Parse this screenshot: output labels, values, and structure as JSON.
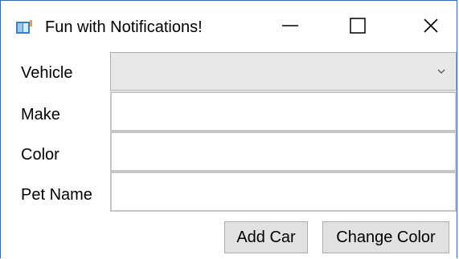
{
  "window": {
    "title": "Fun with Notifications!"
  },
  "form": {
    "vehicle_label": "Vehicle",
    "make_label": "Make",
    "color_label": "Color",
    "pet_name_label": "Pet Name",
    "vehicle_selected": "",
    "make_value": "",
    "color_value": "",
    "pet_name_value": ""
  },
  "buttons": {
    "add_car": "Add Car",
    "change_color": "Change Color"
  },
  "icons": {
    "app": "app-window-icon",
    "minimize": "minimize-icon",
    "maximize": "maximize-icon",
    "close": "close-icon",
    "dropdown": "chevron-down-icon"
  },
  "colors": {
    "window_border": "#2b6fb8",
    "combo_bg": "#e8e8e8",
    "button_bg": "#e1e1e1"
  }
}
